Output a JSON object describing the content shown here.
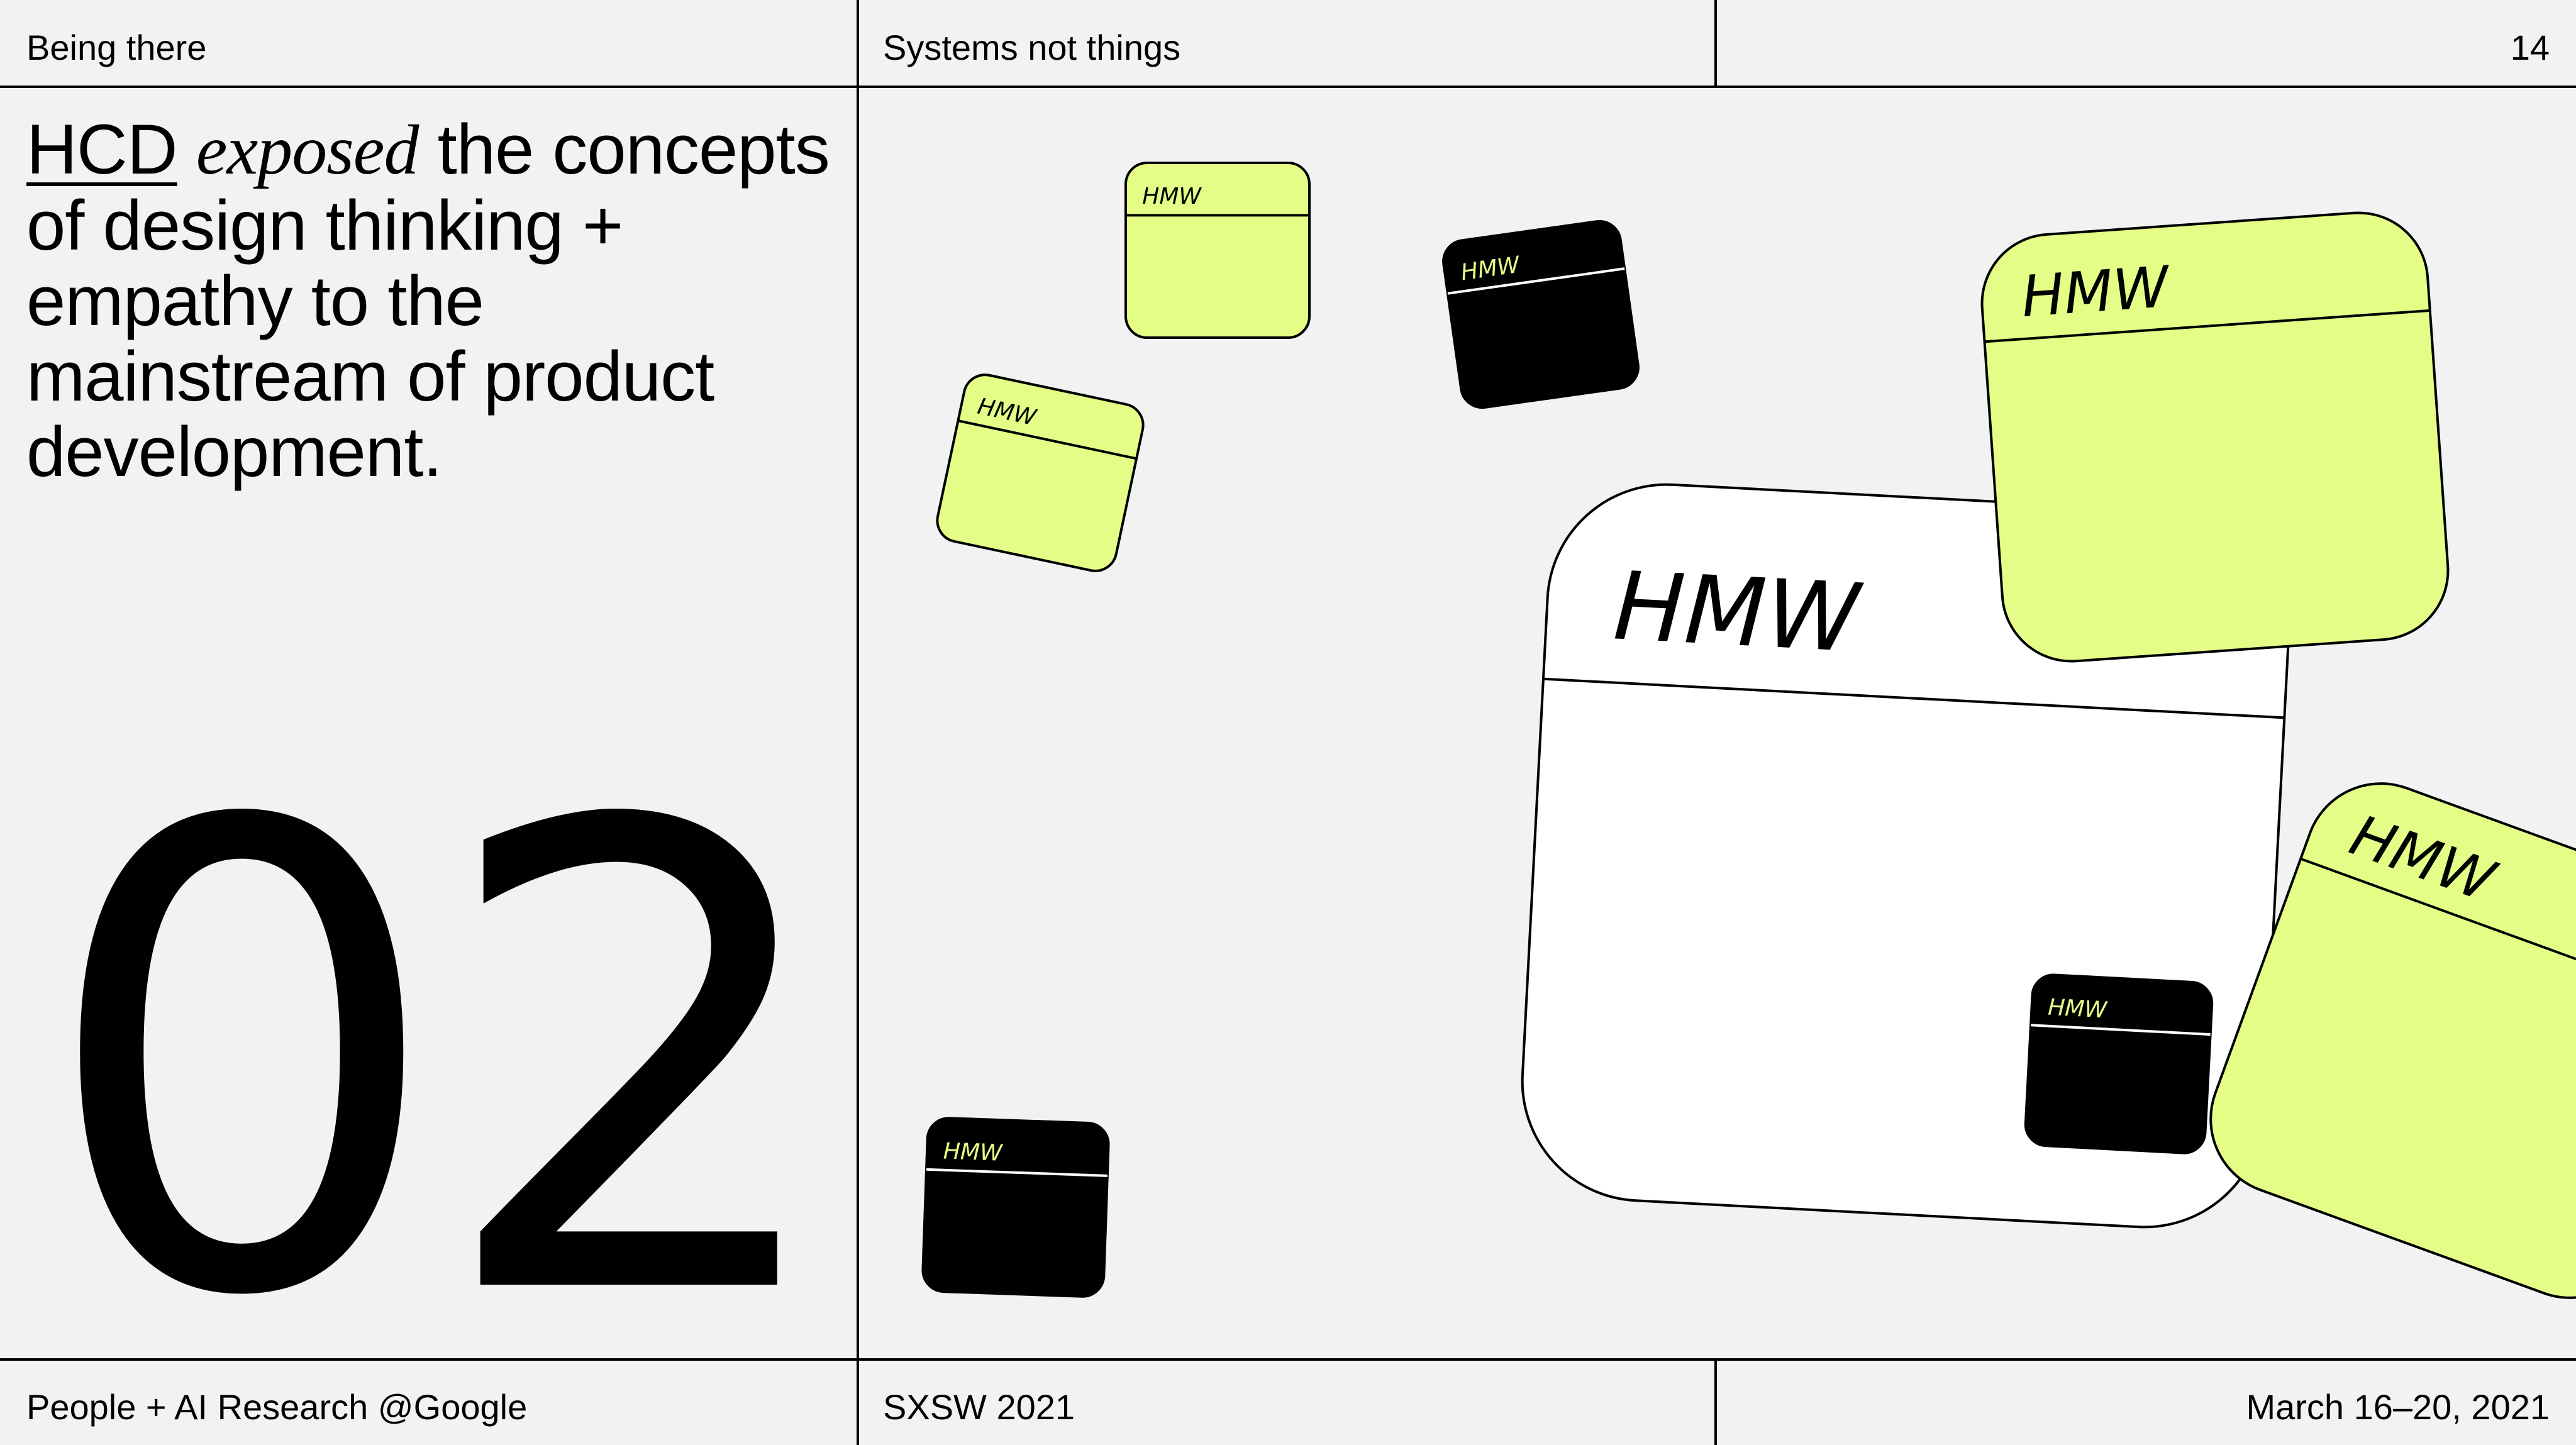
{
  "header": {
    "left": "Being there",
    "center": "Systems not things",
    "page_number": "14"
  },
  "headline": {
    "acronym": "HCD",
    "emphasis": "exposed",
    "rest": " the concepts of design thinking + empathy to the mainstream of product development."
  },
  "section_number": "02",
  "footer": {
    "left": "People + AI Research @Google",
    "center": "SXSW 2021",
    "right": "March 16–20, 2021"
  },
  "sticky_note_label": "HMW",
  "colors": {
    "background": "#f2f2f2",
    "lime": "#e4fd86",
    "black": "#000000",
    "white": "#ffffff"
  }
}
